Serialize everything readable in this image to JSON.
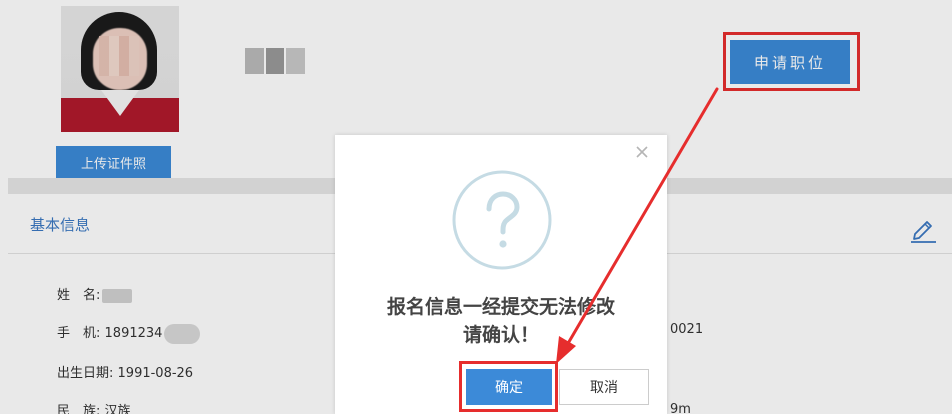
{
  "profile": {
    "upload_label": "上传证件照",
    "apply_label": "申请职位"
  },
  "section": {
    "title": "基本信息",
    "rows": [
      {
        "label": "姓　名:",
        "value": ""
      },
      {
        "label": "手　机:",
        "value": "1891234"
      },
      {
        "label": "出生日期:",
        "value": "1991-08-26"
      },
      {
        "label": "民　族:",
        "value": "汉族"
      }
    ],
    "right_values": [
      "0021",
      "9m"
    ]
  },
  "modal": {
    "line1": "报名信息一经提交无法修改",
    "line2": "请确认！",
    "confirm_label": "确定",
    "cancel_label": "取消",
    "close_symbol": "×",
    "icon": "question-circle-icon"
  },
  "colors": {
    "accent": "#3c8ad8",
    "highlight": "#e62d2d"
  }
}
